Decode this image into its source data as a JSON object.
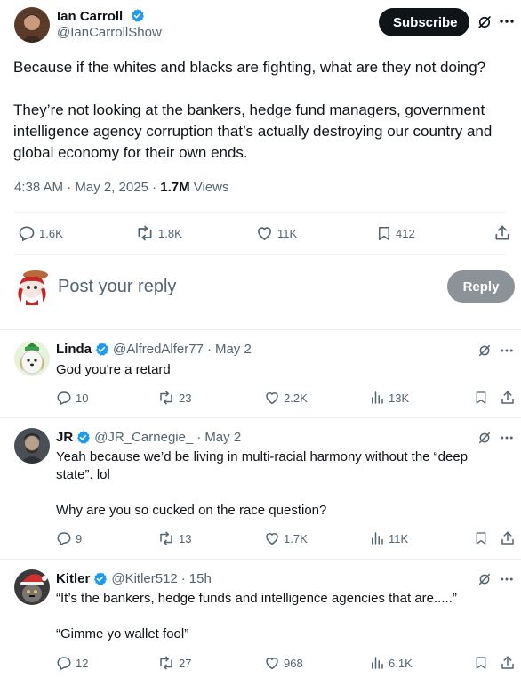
{
  "post": {
    "author_name": "Ian Carroll",
    "author_handle": "@IanCarrollShow",
    "subscribe_label": "Subscribe",
    "text": "Because if the whites and blacks are fighting, what are they not doing?\n\nThey’re not looking at the bankers, hedge fund managers, government intelligence agency corruption that’s actually destroying our country and global economy for their own ends.",
    "time": "4:38 AM · May 2, 2025 · ",
    "views_count": "1.7M",
    "views_label": " Views",
    "stats": {
      "replies": "1.6K",
      "reposts": "1.8K",
      "likes": "11K",
      "bookmarks": "412"
    }
  },
  "composer": {
    "placeholder": "Post your reply",
    "reply_label": "Reply"
  },
  "replies": [
    {
      "name": "Linda",
      "handle": "@AlfredAlfer77",
      "time": "May 2",
      "text": "God you're a retard",
      "stats": {
        "replies": "10",
        "reposts": "23",
        "likes": "2.2K",
        "views": "13K"
      }
    },
    {
      "name": "JR",
      "handle": "@JR_Carnegie_",
      "time": "May 2",
      "text": "Yeah because we’d be living in multi-racial harmony without the “deep state”. lol\n\nWhy are you so cucked on the race question?",
      "stats": {
        "replies": "9",
        "reposts": "13",
        "likes": "1.7K",
        "views": "11K"
      }
    },
    {
      "name": "Kitler",
      "handle": "@Kitler512",
      "time": "15h",
      "text": "“It’s the bankers, hedge funds and intelligence agencies that are.....”\n\n“Gimme yo wallet fool”",
      "stats": {
        "replies": "12",
        "reposts": "27",
        "likes": "968",
        "views": "6.1K"
      }
    }
  ],
  "colors": {
    "text_primary": "#0f1419",
    "text_secondary": "#536471",
    "verified_blue": "#1d9bf0",
    "divider": "#eff3f4",
    "subscribe_bg": "#0f1419",
    "reply_button_bg": "#8b9399"
  },
  "icons": [
    "verified-badge-icon",
    "grok-icon",
    "more-icon",
    "reply-icon",
    "repost-icon",
    "like-icon",
    "bookmark-icon",
    "share-icon",
    "views-icon"
  ]
}
